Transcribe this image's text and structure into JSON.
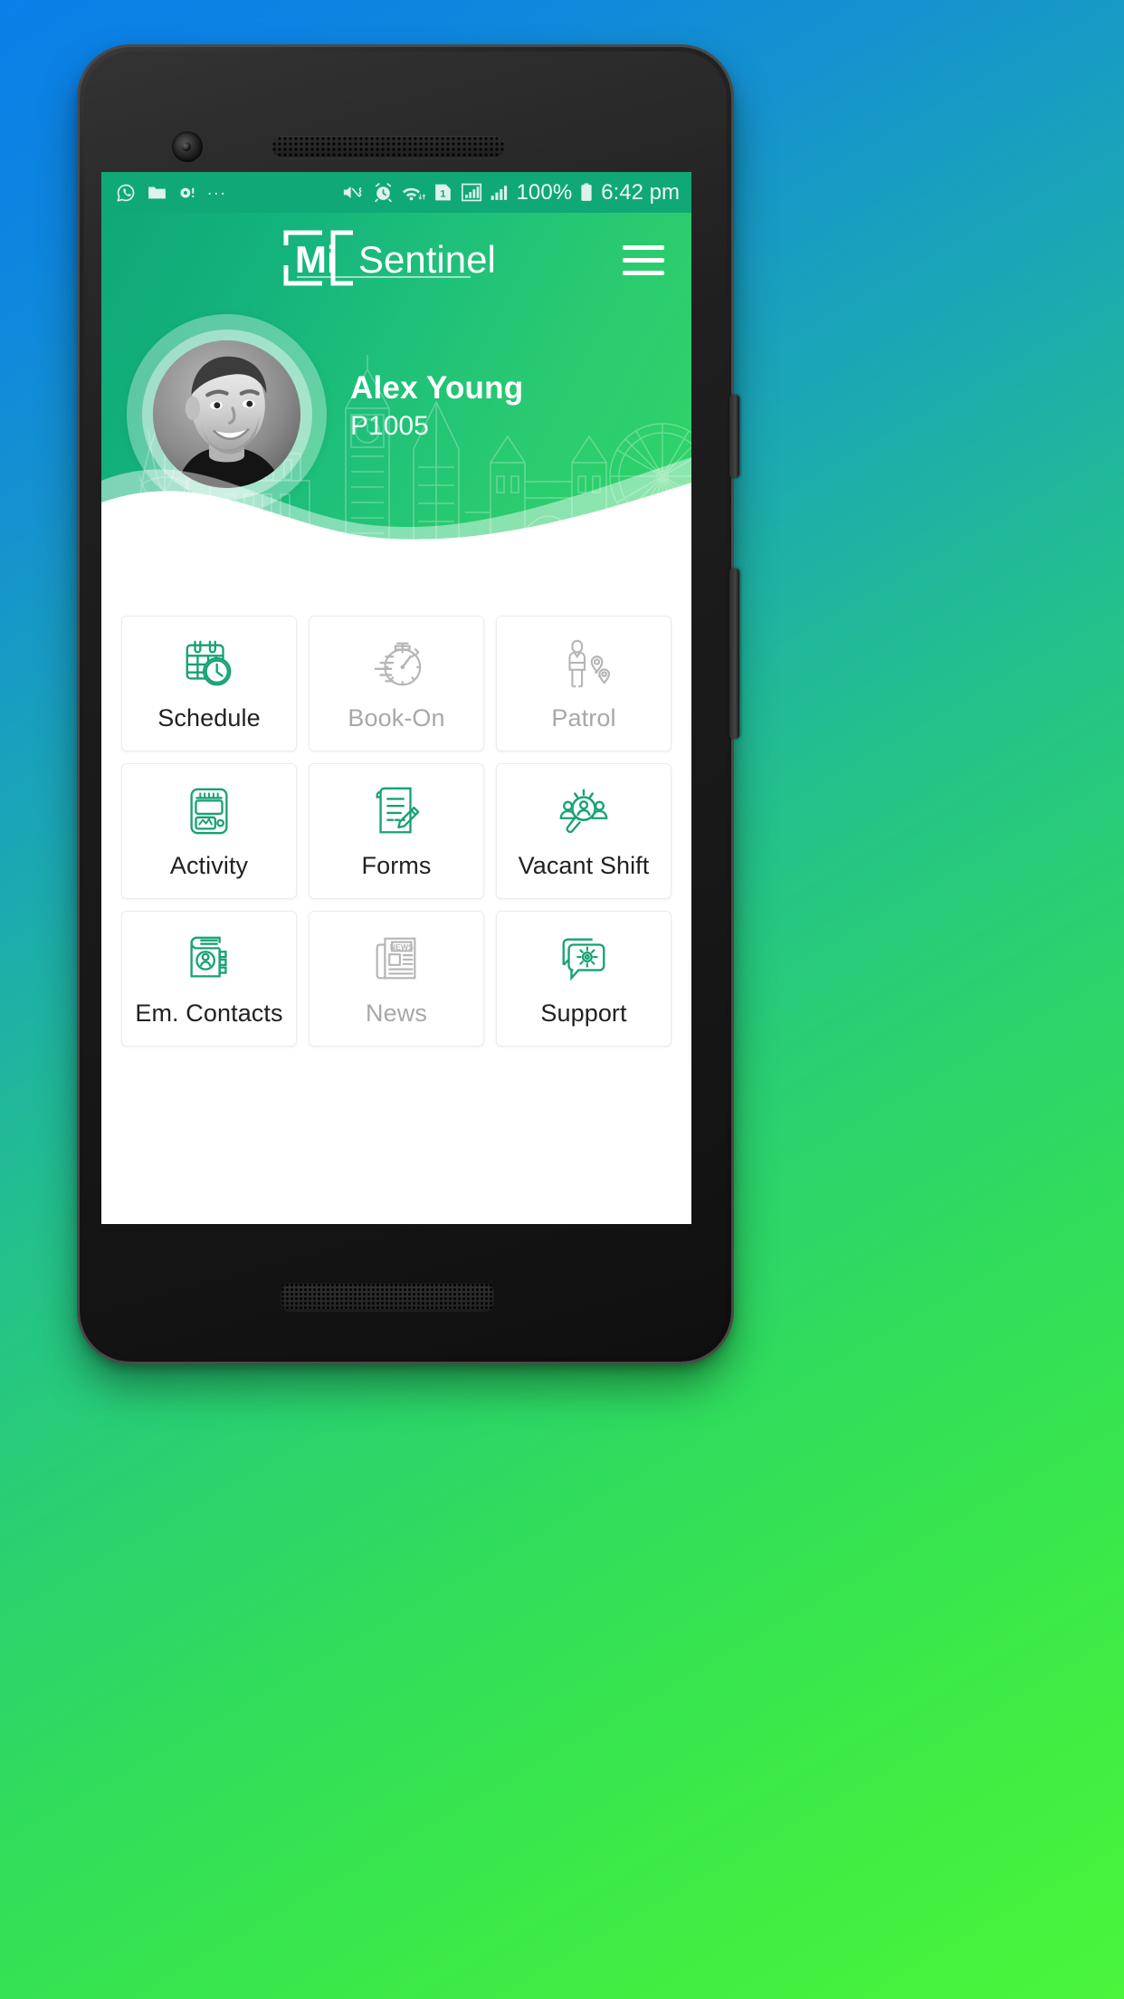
{
  "theme": {
    "brand_green": "#10a877",
    "header_green_start": "#0fa877",
    "header_green_end": "#31d468",
    "disabled_gray": "#a8a8a8",
    "tile_label_color": "#212121"
  },
  "status_bar": {
    "left_icons": [
      "whatsapp-icon",
      "folder-icon",
      "camera-icon",
      "more-dots-icon"
    ],
    "overflow": "...",
    "right_icons": [
      "volume-mute-vibrate-icon",
      "alarm-icon",
      "wifi-icon",
      "sim-1-icon",
      "signal-bars-icon",
      "signal-bars-2-icon"
    ],
    "sim_label": "1",
    "battery_percent": "100%",
    "time": "6:42 pm"
  },
  "header": {
    "logo_mark": "Mi",
    "logo_text": "Sentinel",
    "menu_icon": "hamburger-menu-icon",
    "user": {
      "name": "Alex Young",
      "id": "P1005",
      "avatar": "user-photo"
    }
  },
  "tiles": [
    {
      "label": "Schedule",
      "icon": "calendar-clock-icon",
      "enabled": true
    },
    {
      "label": "Book-On",
      "icon": "stopwatch-icon",
      "enabled": false
    },
    {
      "label": "Patrol",
      "icon": "guard-route-icon",
      "enabled": false
    },
    {
      "label": "Activity",
      "icon": "activity-monitor-icon",
      "enabled": true
    },
    {
      "label": "Forms",
      "icon": "document-pencil-icon",
      "enabled": true
    },
    {
      "label": "Vacant Shift",
      "icon": "people-search-icon",
      "enabled": true
    },
    {
      "label": "Em. Contacts",
      "icon": "contacts-book-icon",
      "enabled": true
    },
    {
      "label": "News",
      "icon": "newspaper-icon",
      "enabled": false
    },
    {
      "label": "Support",
      "icon": "chat-gear-icon",
      "enabled": true
    }
  ],
  "news_icon_text": "NEWS"
}
